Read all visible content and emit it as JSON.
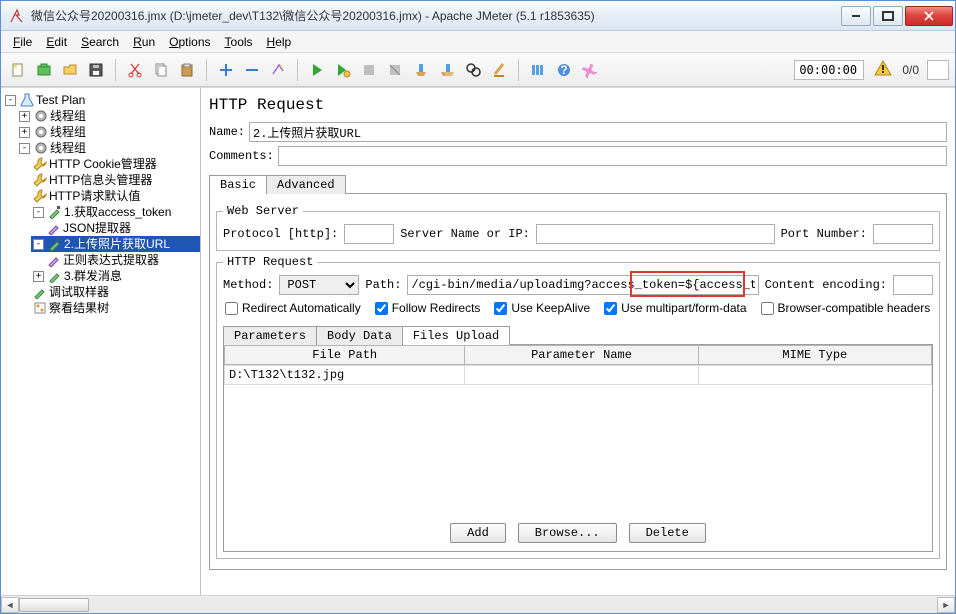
{
  "window": {
    "title": "微信公众号20200316.jmx (D:\\jmeter_dev\\T132\\微信公众号20200316.jmx) - Apache JMeter (5.1 r1853635)"
  },
  "menu": [
    "File",
    "Edit",
    "Search",
    "Run",
    "Options",
    "Tools",
    "Help"
  ],
  "toolbar": {
    "timer": "00:00:00",
    "errcount": "0/0"
  },
  "tree": {
    "root": "Test Plan",
    "tg1": "线程组",
    "tg2": "线程组",
    "tg3": "线程组",
    "cookie": "HTTP Cookie管理器",
    "header": "HTTP信息头管理器",
    "defaults": "HTTP请求默认值",
    "s1": "1.获取access_token",
    "json": "JSON提取器",
    "s2": "2.上传照片获取URL",
    "regex": "正则表达式提取器",
    "s3": "3.群发消息",
    "dbg": "调试取样器",
    "view": "察看结果树"
  },
  "http": {
    "panel_title": "HTTP Request",
    "name_label": "Name:",
    "name_value": "2.上传照片获取URL",
    "comments_label": "Comments:",
    "comments_value": "",
    "tab_basic": "Basic",
    "tab_advanced": "Advanced",
    "ws_legend": "Web Server",
    "proto_label": "Protocol [http]:",
    "proto_value": "",
    "server_label": "Server Name or IP:",
    "server_value": "",
    "port_label": "Port Number:",
    "port_value": "",
    "req_legend": "HTTP Request",
    "method_label": "Method:",
    "method_value": "POST",
    "path_label": "Path:",
    "path_value": "/cgi-bin/media/uploadimg?access_token=${access_token}",
    "enc_label": "Content encoding:",
    "enc_value": "",
    "cb_redirect": "Redirect Automatically",
    "cb_follow": "Follow Redirects",
    "cb_keep": "Use KeepAlive",
    "cb_multi": "Use multipart/form-data",
    "cb_browser": "Browser-compatible headers",
    "itab_params": "Parameters",
    "itab_body": "Body Data",
    "itab_files": "Files Upload",
    "col_path": "File Path",
    "col_param": "Parameter Name",
    "col_mime": "MIME Type",
    "file_row_path": "D:\\T132\\t132.jpg",
    "file_row_param": "",
    "file_row_mime": "",
    "btn_add": "Add",
    "btn_browse": "Browse...",
    "btn_delete": "Delete"
  }
}
